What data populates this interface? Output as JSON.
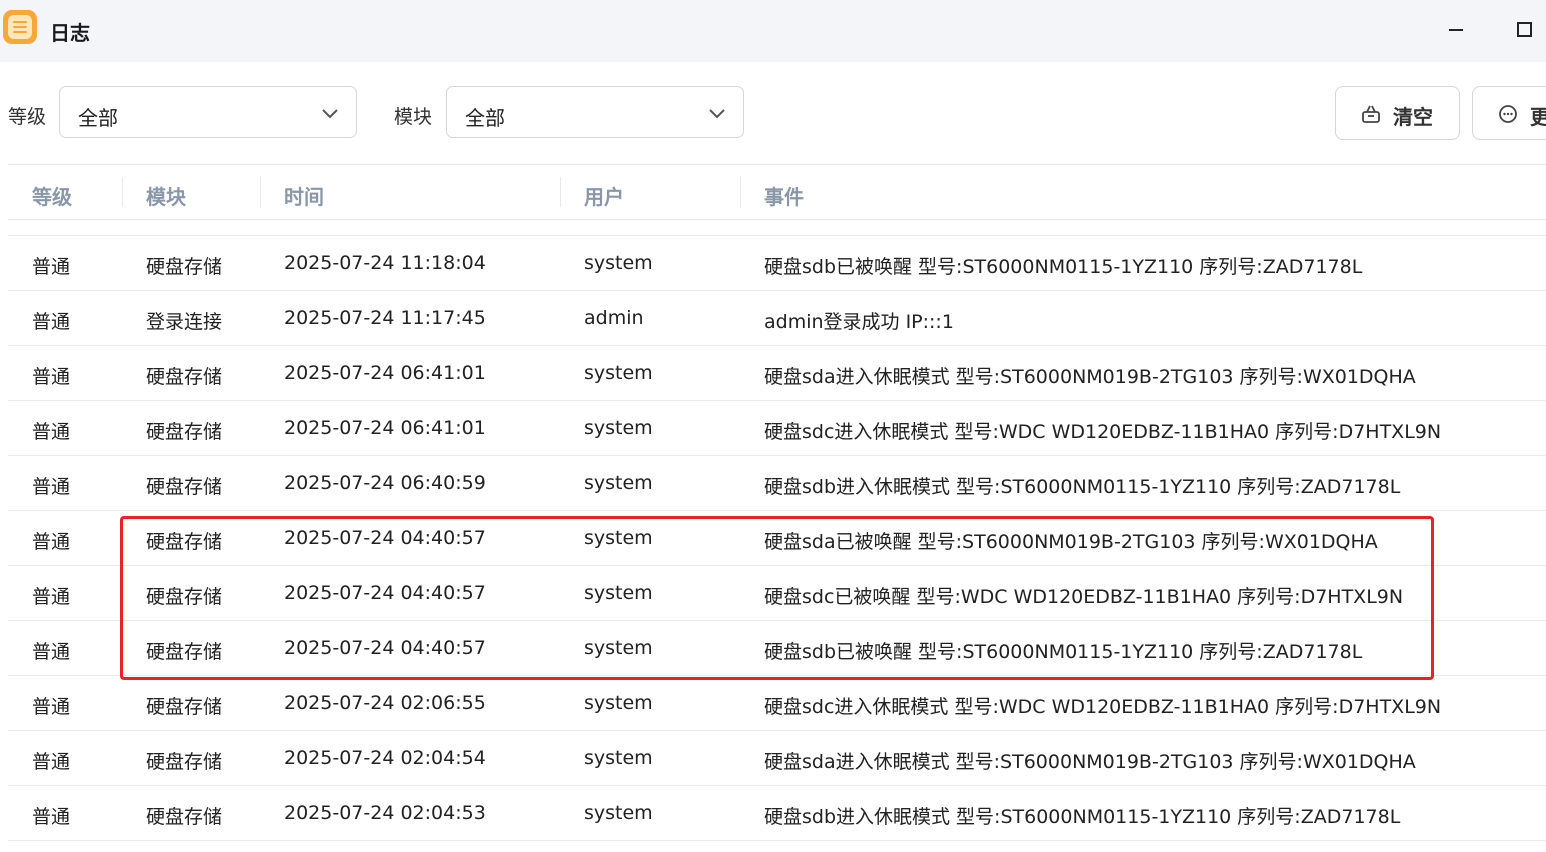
{
  "window": {
    "title": "日志",
    "app_icon": "log-list-icon",
    "minimize_icon": "minimize-icon",
    "maximize_icon": "maximize-icon"
  },
  "filters": {
    "level": {
      "label": "等级",
      "value": "全部"
    },
    "module": {
      "label": "模块",
      "value": "全部"
    }
  },
  "toolbar": {
    "clear_label": "清空",
    "clear_icon": "clear-basket-icon",
    "more_label": "更",
    "more_icon": "more-circle-icon"
  },
  "table": {
    "headers": {
      "level": "等级",
      "module": "模块",
      "time": "时间",
      "user": "用户",
      "event": "事件"
    },
    "rows": [
      {
        "level": "普通",
        "module": "硬盘存储",
        "time": "2025-07-24 11:18:04",
        "user": "system",
        "event": "硬盘sdb已被唤醒 型号:ST6000NM0115-1YZ110 序列号:ZAD7178L"
      },
      {
        "level": "普通",
        "module": "登录连接",
        "time": "2025-07-24 11:17:45",
        "user": "admin",
        "event": "admin登录成功 IP:::1"
      },
      {
        "level": "普通",
        "module": "硬盘存储",
        "time": "2025-07-24 06:41:01",
        "user": "system",
        "event": "硬盘sda进入休眠模式 型号:ST6000NM019B-2TG103 序列号:WX01DQHA"
      },
      {
        "level": "普通",
        "module": "硬盘存储",
        "time": "2025-07-24 06:41:01",
        "user": "system",
        "event": "硬盘sdc进入休眠模式 型号:WDC WD120EDBZ-11B1HA0 序列号:D7HTXL9N"
      },
      {
        "level": "普通",
        "module": "硬盘存储",
        "time": "2025-07-24 06:40:59",
        "user": "system",
        "event": "硬盘sdb进入休眠模式 型号:ST6000NM0115-1YZ110 序列号:ZAD7178L"
      },
      {
        "level": "普通",
        "module": "硬盘存储",
        "time": "2025-07-24 04:40:57",
        "user": "system",
        "event": "硬盘sda已被唤醒 型号:ST6000NM019B-2TG103 序列号:WX01DQHA"
      },
      {
        "level": "普通",
        "module": "硬盘存储",
        "time": "2025-07-24 04:40:57",
        "user": "system",
        "event": "硬盘sdc已被唤醒 型号:WDC WD120EDBZ-11B1HA0 序列号:D7HTXL9N"
      },
      {
        "level": "普通",
        "module": "硬盘存储",
        "time": "2025-07-24 04:40:57",
        "user": "system",
        "event": "硬盘sdb已被唤醒 型号:ST6000NM0115-1YZ110 序列号:ZAD7178L"
      },
      {
        "level": "普通",
        "module": "硬盘存储",
        "time": "2025-07-24 02:06:55",
        "user": "system",
        "event": "硬盘sdc进入休眠模式 型号:WDC WD120EDBZ-11B1HA0 序列号:D7HTXL9N"
      },
      {
        "level": "普通",
        "module": "硬盘存储",
        "time": "2025-07-24 02:04:54",
        "user": "system",
        "event": "硬盘sda进入休眠模式 型号:ST6000NM019B-2TG103 序列号:WX01DQHA"
      },
      {
        "level": "普通",
        "module": "硬盘存储",
        "time": "2025-07-24 02:04:53",
        "user": "system",
        "event": "硬盘sdb进入休眠模式 型号:ST6000NM0115-1YZ110 序列号:ZAD7178L"
      }
    ]
  },
  "annotation": {
    "color": "#e8222a",
    "highlighted_rows": [
      5,
      6,
      7
    ]
  }
}
